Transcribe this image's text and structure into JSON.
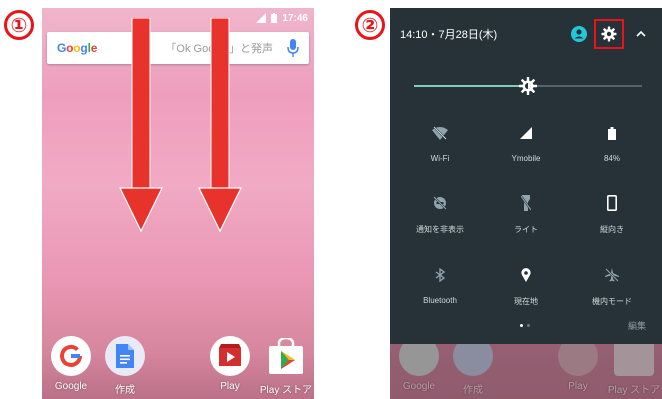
{
  "panel1": {
    "step": "①",
    "status_time": "17:46",
    "search": {
      "logo": "Google",
      "hint": "「Ok Google」と発声"
    },
    "dock": [
      {
        "label": "Google",
        "icon": "google-app-icon"
      },
      {
        "label": "作成",
        "icon": "docs-icon"
      },
      {
        "label": "Play",
        "icon": "play-movies-icon"
      },
      {
        "label": "Play ストア",
        "icon": "play-store-icon"
      }
    ]
  },
  "panel2": {
    "step": "②",
    "datetime": "14:10・7月28日(木)",
    "brightness_level": 0.5,
    "tiles": [
      {
        "label": "Wi-Fi",
        "icon": "wifi-off-icon"
      },
      {
        "label": "Ymobile",
        "icon": "signal-icon"
      },
      {
        "label": "84%",
        "icon": "battery-icon"
      },
      {
        "label": "通知を非表示",
        "icon": "do-not-disturb-icon"
      },
      {
        "label": "ライト",
        "icon": "flashlight-icon"
      },
      {
        "label": "縦向き",
        "icon": "portrait-icon"
      },
      {
        "label": "Bluetooth",
        "icon": "bluetooth-icon"
      },
      {
        "label": "現在地",
        "icon": "location-icon"
      },
      {
        "label": "機内モード",
        "icon": "airplane-icon"
      }
    ],
    "edit": "編集",
    "dock": [
      {
        "label": "Google"
      },
      {
        "label": "作成"
      },
      {
        "label": "Play"
      },
      {
        "label": "Play ストア"
      }
    ]
  },
  "colors": {
    "accent_red": "#e8141a",
    "shade_bg": "#263238",
    "slider_teal": "#80cbc4"
  }
}
